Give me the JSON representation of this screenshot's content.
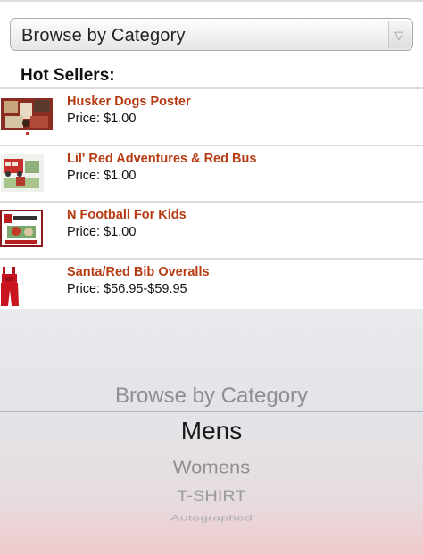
{
  "select": {
    "label": "Browse by Category"
  },
  "hot_sellers": {
    "title": "Hot Sellers:",
    "items": [
      {
        "name": "Husker Dogs Poster",
        "price": "Price: $1.00",
        "thumb": "poster-thumbnail"
      },
      {
        "name": "Lil' Red Adventures & Red Bus",
        "price": "Price: $1.00",
        "thumb": "book-thumbnail"
      },
      {
        "name": "N Football For Kids",
        "price": "Price: $1.00",
        "thumb": "book-thumbnail"
      },
      {
        "name": "Santa/Red Bib Overalls",
        "price": "Price: $56.95-$59.95",
        "thumb": "overalls-thumbnail"
      }
    ]
  },
  "picker": {
    "options": [
      "Browse by Category",
      "Mens",
      "Womens",
      "T-SHIRT",
      "Autographed"
    ],
    "selected": "Mens"
  },
  "colors": {
    "product_name": "#b63b12",
    "picker_bg": "#e3e4e8"
  }
}
